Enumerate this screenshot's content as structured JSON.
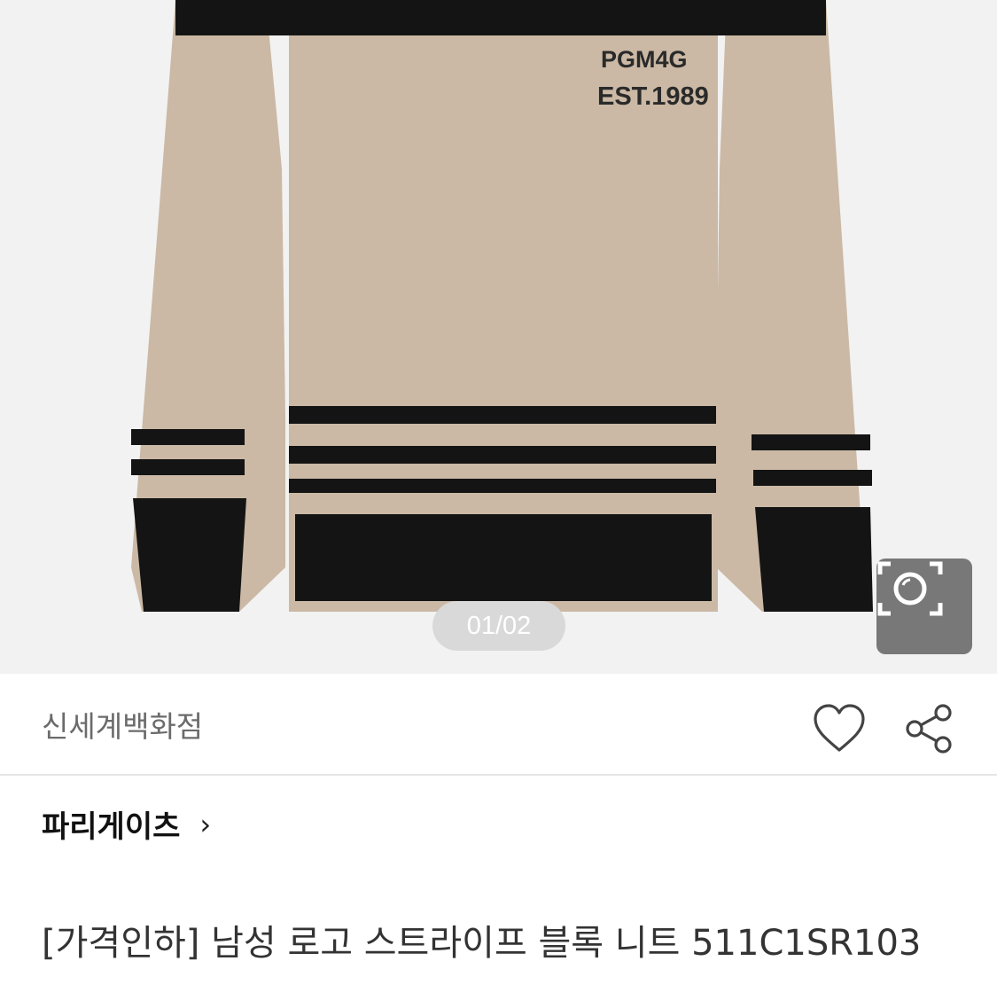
{
  "gallery": {
    "page_indicator": "01/02",
    "sweater_print_line1": "PGM4G",
    "sweater_print_line2": "EST.1989",
    "colors": {
      "beige": "#cbb9a5",
      "black": "#141414"
    }
  },
  "icons": {
    "lens": "lens-search-icon",
    "heart": "heart-icon",
    "share": "share-icon",
    "chevron": "chevron-right-icon"
  },
  "store": {
    "name": "신세계백화점"
  },
  "brand": {
    "name": "파리게이츠",
    "chevron": "›"
  },
  "product": {
    "title": "[가격인하] 남성 로고 스트라이프 블록 니트 511C1SR103"
  }
}
